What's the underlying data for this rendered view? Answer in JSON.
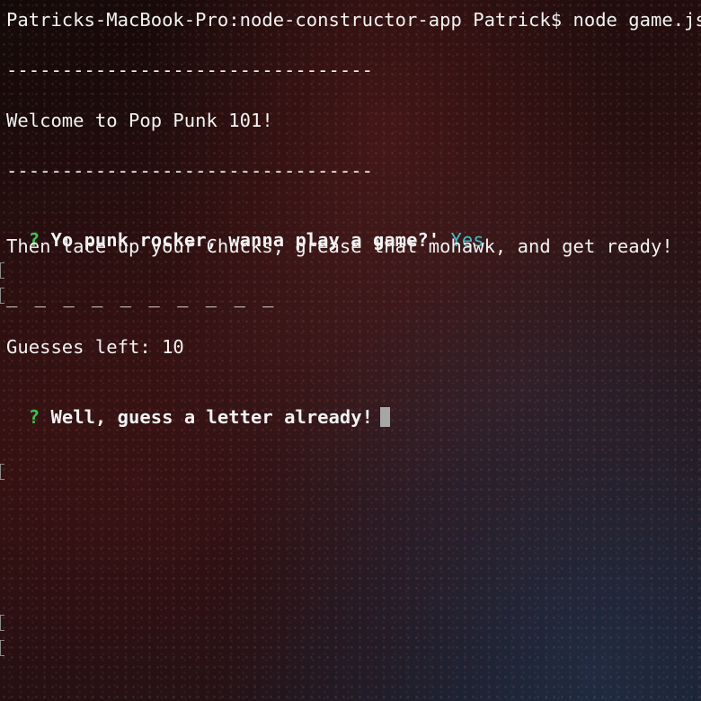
{
  "terminal": {
    "command_line": "Patricks-MacBook-Pro:node-constructor-app Patrick$ node game.js",
    "divider_top": "---------------------------------",
    "welcome": "Welcome to Pop Punk 101!",
    "divider_bottom": "---------------------------------",
    "question1": {
      "mark": "?",
      "text": "Yo punk rocker, wanna play a game?'",
      "answer": "Yes"
    },
    "response": "Then lace up your Chucks, grease that mohawk, and get ready!",
    "word_blanks": "_ _ _ _ _ _ _ _ _ _",
    "guesses_left": "Guesses left: 10",
    "question2": {
      "mark": "?",
      "text": "Well, guess a letter already!"
    }
  }
}
